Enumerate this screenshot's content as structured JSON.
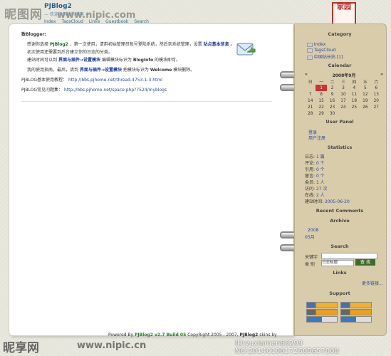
{
  "header": {
    "blog_title": "PJBlog2",
    "blog_subtitle": "— 欢迎来到我的博客 —",
    "nav": [
      "Index",
      "TagsCloud",
      "Links",
      "Guestbook",
      "Search"
    ],
    "watermark_cn": "昵图网",
    "watermark_url": "www.nipic.com",
    "seal_text": "家园"
  },
  "main": {
    "greeting": "致Blogger:",
    "p1_a": "感谢你选择",
    "p1_brand": "PJBlog2",
    "p1_b": "，第一次使用，请用初始管理员账号登陆系统，然后到系统管理，设置",
    "p1_link": "站点基本信息",
    "p1_c": "。",
    "p2": "初次使用还需要到后台建立你的日志的分类。",
    "p3_a": "建站时间可以到",
    "p3_link": "界面与插件→设置模块",
    "p3_b": "编辑模块标识为",
    "p3_key": "BlogInfo",
    "p3_c": "的模块即可。",
    "p4_a": "我的使用指南。最后，请到",
    "p4_link": "界面与插件→设置模块",
    "p4_b": "把模块标识为",
    "p4_key": "Welcome",
    "p4_c": "模块删除。",
    "tutorial_label": "PJBLOG基本使用教程：",
    "tutorial_url": "http://bbs.pjhome.net/thread-4753-1-3.html",
    "faq_label": "PJBLOG常见问题集：",
    "faq_url": "http://bbs.pjhome.net/space.php?7524/myblogs",
    "footer_a": "Powered By",
    "footer_brand": "PJBlog2 v2.7 Build 05",
    "footer_b": "CopyRight 2005 - 2007,",
    "footer_c": "PJBlog2",
    "footer_d": "skins by"
  },
  "sidebar": {
    "category_title": "Category",
    "category_items": [
      "Index",
      "TagsCloud",
      "中国站长站 [1]"
    ],
    "calendar_title": "Calendar",
    "calendar_month": "2008年9月",
    "weekdays": [
      "日",
      "一",
      "二",
      "三",
      "四",
      "五",
      "六"
    ],
    "calendar_rows": [
      [
        "",
        "1",
        "2",
        "3",
        "4",
        "5",
        "6"
      ],
      [
        "7",
        "8",
        "9",
        "10",
        "11",
        "12",
        "13"
      ],
      [
        "14",
        "15",
        "16",
        "17",
        "18",
        "19",
        "20"
      ],
      [
        "21",
        "22",
        "23",
        "24",
        "25",
        "26",
        "27"
      ],
      [
        "28",
        "29",
        "30",
        "",
        "",
        "",
        ""
      ]
    ],
    "today": "1",
    "userpanel_title": "User Panel",
    "userpanel_items": [
      "登录",
      "用户注册"
    ],
    "stats_title": "Statistics",
    "stats": [
      {
        "label": "日志:",
        "value": "1 篇"
      },
      {
        "label": "评论:",
        "value": "0 个"
      },
      {
        "label": "引用:",
        "value": "0 个"
      },
      {
        "label": "留言:",
        "value": "0 个"
      },
      {
        "label": "会员:",
        "value": "1 人"
      },
      {
        "label": "访问:",
        "value": "27 次"
      },
      {
        "label": "在线:",
        "value": "2 人"
      },
      {
        "label": "建站时间:",
        "value": "2005-06-20"
      }
    ],
    "recent_comments_title": "Recent Comments",
    "archive_title": "Archive",
    "archive_items": [
      "2008",
      "05月"
    ],
    "search_title": "Search",
    "search_keyword_label": "关键字",
    "search_type_label": "类 别",
    "search_select": "日志标题",
    "search_button": "查 找",
    "links_title": "Links",
    "links_more": "更多链接...",
    "support_title": "Support"
  },
  "bottom_watermark": {
    "cn": "昵享网",
    "url": "www.nipic.cn",
    "id": "ID:yuxiamen83299 NO:20140106172605657000"
  }
}
